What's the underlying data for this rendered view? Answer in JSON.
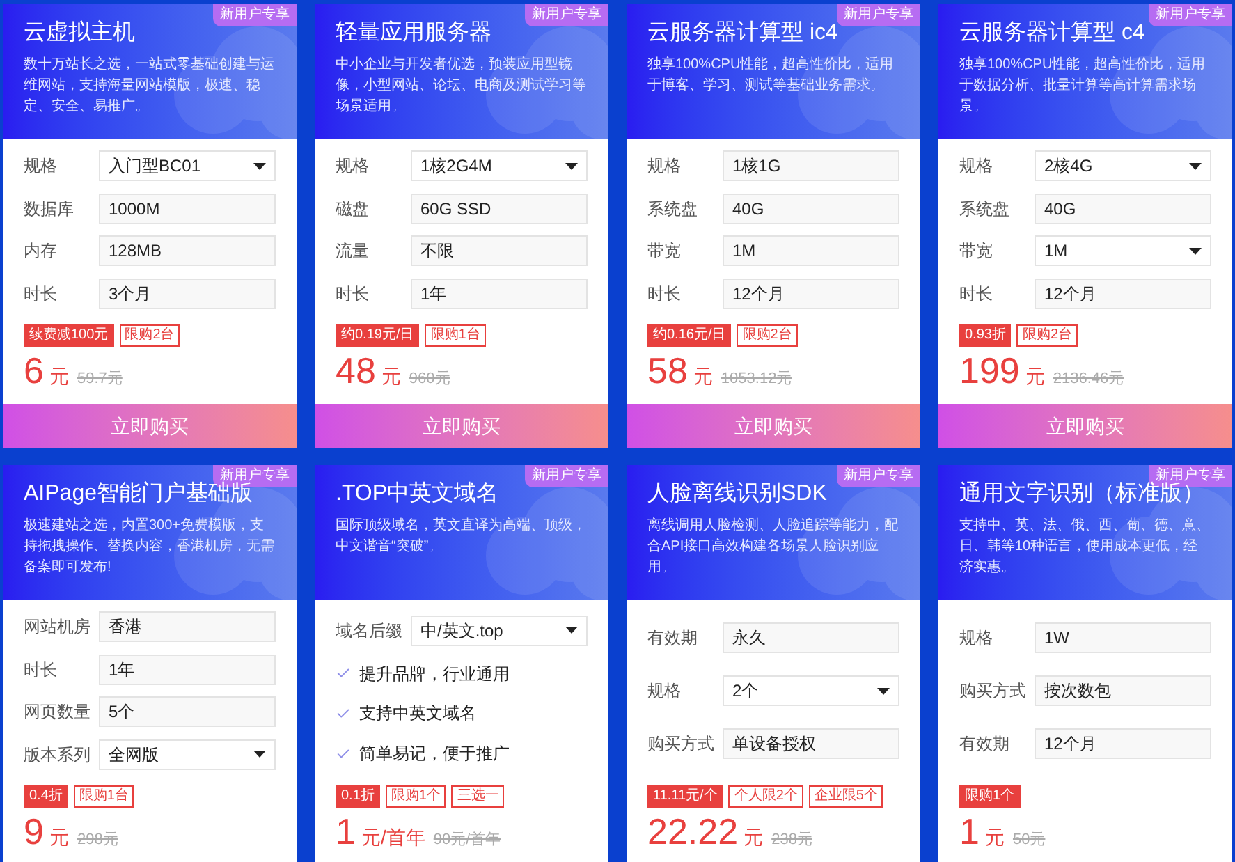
{
  "cards": [
    {
      "badge": "新用户专享",
      "title": "云虚拟主机",
      "description": "数十万站长之选，一站式零基础创建与运维网站，支持海量网站模版，极速、稳定、安全、易推广。",
      "options": [
        {
          "label": "规格",
          "value": "入门型BC01",
          "kind": "select"
        },
        {
          "label": "数据库",
          "value": "1000M",
          "kind": "text"
        },
        {
          "label": "内存",
          "value": "128MB",
          "kind": "text"
        },
        {
          "label": "时长",
          "value": "3个月",
          "kind": "text"
        }
      ],
      "tags": [
        {
          "text": "续费减100元",
          "kind": "filled"
        },
        {
          "text": "限购2台",
          "kind": "outline"
        }
      ],
      "price": {
        "amount": "6",
        "unit": "元",
        "original": "59.7元"
      },
      "buy_button": "立即购买"
    },
    {
      "badge": "新用户专享",
      "title": "轻量应用服务器",
      "description": "中小企业与开发者优选，预装应用型镜像，小型网站、论坛、电商及测试学习等场景适用。",
      "options": [
        {
          "label": "规格",
          "value": "1核2G4M",
          "kind": "select"
        },
        {
          "label": "磁盘",
          "value": "60G SSD",
          "kind": "text"
        },
        {
          "label": "流量",
          "value": "不限",
          "kind": "text"
        },
        {
          "label": "时长",
          "value": "1年",
          "kind": "text"
        }
      ],
      "tags": [
        {
          "text": "约0.19元/日",
          "kind": "filled"
        },
        {
          "text": "限购1台",
          "kind": "outline"
        }
      ],
      "price": {
        "amount": "48",
        "unit": "元",
        "original": "960元"
      },
      "buy_button": "立即购买"
    },
    {
      "badge": "新用户专享",
      "title": "云服务器计算型 ic4",
      "description": "独享100%CPU性能，超高性价比，适用于博客、学习、测试等基础业务需求。",
      "options": [
        {
          "label": "规格",
          "value": "1核1G",
          "kind": "text"
        },
        {
          "label": "系统盘",
          "value": "40G",
          "kind": "text"
        },
        {
          "label": "带宽",
          "value": "1M",
          "kind": "text"
        },
        {
          "label": "时长",
          "value": "12个月",
          "kind": "text"
        }
      ],
      "tags": [
        {
          "text": "约0.16元/日",
          "kind": "filled"
        },
        {
          "text": "限购2台",
          "kind": "outline"
        }
      ],
      "price": {
        "amount": "58",
        "unit": "元",
        "original": "1053.12元"
      },
      "buy_button": "立即购买"
    },
    {
      "badge": "新用户专享",
      "title": "云服务器计算型 c4",
      "description": "独享100%CPU性能，超高性价比，适用于数据分析、批量计算等高计算需求场景。",
      "options": [
        {
          "label": "规格",
          "value": "2核4G",
          "kind": "select"
        },
        {
          "label": "系统盘",
          "value": "40G",
          "kind": "text"
        },
        {
          "label": "带宽",
          "value": "1M",
          "kind": "select"
        },
        {
          "label": "时长",
          "value": "12个月",
          "kind": "text"
        }
      ],
      "tags": [
        {
          "text": "0.93折",
          "kind": "filled"
        },
        {
          "text": "限购2台",
          "kind": "outline"
        }
      ],
      "price": {
        "amount": "199",
        "unit": "元",
        "original": "2136.46元"
      },
      "buy_button": "立即购买"
    },
    {
      "badge": "新用户专享",
      "title": "AIPage智能门户基础版",
      "description": "极速建站之选，内置300+免费模版，支持拖拽操作、替换内容，香港机房，无需备案即可发布!",
      "options": [
        {
          "label": "网站机房",
          "value": "香港",
          "kind": "text"
        },
        {
          "label": "时长",
          "value": "1年",
          "kind": "text"
        },
        {
          "label": "网页数量",
          "value": "5个",
          "kind": "text"
        },
        {
          "label": "版本系列",
          "value": "全网版",
          "kind": "select"
        }
      ],
      "tags": [
        {
          "text": "0.4折",
          "kind": "filled"
        },
        {
          "text": "限购1台",
          "kind": "outline"
        }
      ],
      "price": {
        "amount": "9",
        "unit": "元",
        "original": "298元"
      }
    },
    {
      "badge": "新用户专享",
      "title": ".TOP中英文域名",
      "description": "国际顶级域名，英文直译为高端、顶级，中文谐音“突破”。",
      "options": [
        {
          "label": "域名后缀",
          "value": "中/英文.top",
          "kind": "select"
        }
      ],
      "features": [
        "提升品牌，行业通用",
        "支持中英文域名",
        "简单易记，便于推广"
      ],
      "tags": [
        {
          "text": "0.1折",
          "kind": "filled"
        },
        {
          "text": "限购1个",
          "kind": "outline"
        },
        {
          "text": "三选一",
          "kind": "outline"
        }
      ],
      "price": {
        "amount": "1",
        "unit": "元/首年",
        "original": "90元/首年"
      }
    },
    {
      "badge": "新用户专享",
      "title": "人脸离线识别SDK",
      "description": "离线调用人脸检测、人脸追踪等能力，配合API接口高效构建各场景人脸识别应用。",
      "options": [
        {
          "label": "有效期",
          "value": "永久",
          "kind": "text"
        },
        {
          "label": "规格",
          "value": "2个",
          "kind": "select"
        },
        {
          "label": "购买方式",
          "value": "单设备授权",
          "kind": "text"
        }
      ],
      "tags": [
        {
          "text": "11.11元/个",
          "kind": "filled"
        },
        {
          "text": "个人限2个",
          "kind": "outline"
        },
        {
          "text": "企业限5个",
          "kind": "outline"
        }
      ],
      "price": {
        "amount": "22.22",
        "unit": "元",
        "original": "238元"
      }
    },
    {
      "badge": "新用户专享",
      "title": "通用文字识别（标准版）",
      "description": "支持中、英、法、俄、西、葡、德、意、日、韩等10种语言，使用成本更低，经济实惠。",
      "options": [
        {
          "label": "规格",
          "value": "1W",
          "kind": "text"
        },
        {
          "label": "购买方式",
          "value": "按次数包",
          "kind": "text"
        },
        {
          "label": "有效期",
          "value": "12个月",
          "kind": "text"
        }
      ],
      "tags": [
        {
          "text": "限购1个",
          "kind": "filled"
        }
      ],
      "price": {
        "amount": "1",
        "unit": "元",
        "original": "50元"
      }
    }
  ]
}
